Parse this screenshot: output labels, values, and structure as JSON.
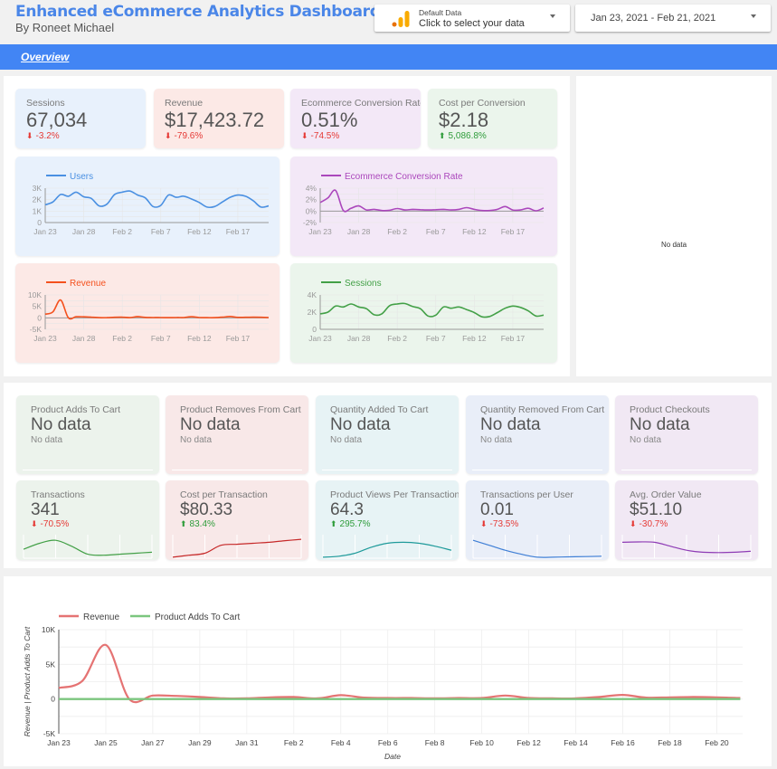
{
  "header": {
    "title": "Enhanced eCommerce Analytics  Dashboard",
    "subtitle": "By Roneet Michael",
    "data_source": {
      "label": "Default Data",
      "action": "Click to select your data",
      "icon": "google-analytics-icon"
    },
    "date_range": "Jan 23, 2021 - Feb 21, 2021"
  },
  "nav": {
    "tabs": [
      {
        "label": "Overview",
        "active": true
      }
    ]
  },
  "kpis_top": [
    {
      "label": "Sessions",
      "value": "67,034",
      "delta": "-3.2%",
      "trend": "down",
      "bg": "#e8f1fc"
    },
    {
      "label": "Revenue",
      "value": "$17,423.72",
      "delta": "-79.6%",
      "trend": "down",
      "bg": "#fce9e6"
    },
    {
      "label": "Ecommerce Conversion Rate",
      "value": "0.51%",
      "delta": "-74.5%",
      "trend": "down",
      "bg": "#f3e8f7"
    },
    {
      "label": "Cost per Conversion",
      "value": "$2.18",
      "delta": "5,086.8%",
      "trend": "up",
      "bg": "#ebf5ec"
    }
  ],
  "side_panel": {
    "message": "No data"
  },
  "kpis_nodata": [
    {
      "label": "Product Adds To Cart",
      "value": "No data",
      "sub": "No data",
      "bg": "#ecf3ec"
    },
    {
      "label": "Product Removes From Cart",
      "value": "No data",
      "sub": "No data",
      "bg": "#f8e8e8"
    },
    {
      "label": "Quantity Added To Cart",
      "value": "No data",
      "sub": "No data",
      "bg": "#e7f3f5"
    },
    {
      "label": "Quantity Removed From Cart",
      "value": "No data",
      "sub": "No data",
      "bg": "#e9eef8"
    },
    {
      "label": "Product Checkouts",
      "value": "No data",
      "sub": "No data",
      "bg": "#f1e8f4"
    }
  ],
  "kpis_spark": [
    {
      "label": "Transactions",
      "value": "341",
      "delta": "-70.5%",
      "trend": "down",
      "bg": "#ecf3ec",
      "color": "#43a047",
      "spark": [
        0.45,
        0.75,
        0.9,
        0.6,
        0.2,
        0.15,
        0.2,
        0.25,
        0.3
      ]
    },
    {
      "label": "Cost per Transaction",
      "value": "$80.33",
      "delta": "83.4%",
      "trend": "up",
      "bg": "#f8e8e8",
      "color": "#c62828",
      "spark": [
        0.05,
        0.15,
        0.25,
        0.65,
        0.7,
        0.75,
        0.8,
        0.88,
        0.95
      ]
    },
    {
      "label": "Product Views Per Transaction",
      "value": "64.3",
      "delta": "295.7%",
      "trend": "up",
      "bg": "#e7f3f5",
      "color": "#1e9a9a",
      "spark": [
        0.05,
        0.1,
        0.25,
        0.55,
        0.75,
        0.8,
        0.75,
        0.6,
        0.4
      ]
    },
    {
      "label": "Transactions per User",
      "value": "0.01",
      "delta": "-73.5%",
      "trend": "down",
      "bg": "#e9eef8",
      "color": "#3f7fd6",
      "spark": [
        0.9,
        0.65,
        0.4,
        0.2,
        0.05,
        0.05,
        0.07,
        0.08,
        0.1
      ]
    },
    {
      "label": "Avg. Order Value",
      "value": "$51.10",
      "delta": "-30.7%",
      "trend": "down",
      "bg": "#f1e8f4",
      "color": "#8e3bb5",
      "spark": [
        0.8,
        0.82,
        0.8,
        0.6,
        0.4,
        0.3,
        0.28,
        0.3,
        0.35
      ]
    }
  ],
  "chart_data": [
    {
      "type": "line",
      "title": "Users",
      "color": "#4a90e2",
      "bg": "#e8f1fc",
      "ylim": [
        0,
        3000
      ],
      "yticks": [
        "0",
        "1K",
        "2K",
        "3K"
      ],
      "ytick_values": [
        0,
        1000,
        2000,
        3000
      ],
      "xticks": [
        "Jan 23",
        "Jan 28",
        "Feb 2",
        "Feb 7",
        "Feb 12",
        "Feb 17"
      ],
      "values": [
        1550,
        1800,
        2450,
        2300,
        2650,
        2250,
        2100,
        1450,
        1600,
        2450,
        2650,
        2750,
        2400,
        2150,
        1400,
        1500,
        2400,
        2200,
        2300,
        2050,
        1750,
        1350,
        1400,
        1800,
        2200,
        2400,
        2300,
        1900,
        1350,
        1450
      ]
    },
    {
      "type": "line",
      "title": "Ecommerce Conversion Rate",
      "color": "#ab47bc",
      "bg": "#f3e8f7",
      "ylim": [
        -2,
        4
      ],
      "yticks": [
        "-2%",
        "0%",
        "2%",
        "4%"
      ],
      "ytick_values": [
        -2,
        0,
        2,
        4
      ],
      "xticks": [
        "Jan 23",
        "Jan 28",
        "Feb 2",
        "Feb 7",
        "Feb 12",
        "Feb 17"
      ],
      "values": [
        1.5,
        2.3,
        3.6,
        0.1,
        0.5,
        0.9,
        0.2,
        0.3,
        0.1,
        0.15,
        0.45,
        0.2,
        0.3,
        0.25,
        0.2,
        0.25,
        0.3,
        0.2,
        0.3,
        0.6,
        0.3,
        0.1,
        0.1,
        0.3,
        0.8,
        0.2,
        0.2,
        0.5,
        0.05,
        0.55
      ]
    },
    {
      "type": "line",
      "title": "Revenue",
      "color": "#f4511e",
      "bg": "#fce9e6",
      "ylim": [
        -5000,
        10000
      ],
      "yticks": [
        "-5K",
        "0",
        "5K",
        "10K"
      ],
      "ytick_values": [
        -5000,
        0,
        5000,
        10000
      ],
      "xticks": [
        "Jan 23",
        "Jan 28",
        "Feb 2",
        "Feb 7",
        "Feb 12",
        "Feb 17"
      ],
      "values": [
        1600,
        2600,
        7800,
        0,
        500,
        450,
        300,
        100,
        100,
        250,
        300,
        100,
        550,
        200,
        150,
        150,
        100,
        150,
        150,
        500,
        150,
        100,
        100,
        300,
        600,
        200,
        250,
        300,
        250,
        150
      ]
    },
    {
      "type": "line",
      "title": "Sessions",
      "color": "#43a047",
      "bg": "#ebf5ec",
      "ylim": [
        0,
        4000
      ],
      "yticks": [
        "0",
        "2K",
        "4K"
      ],
      "ytick_values": [
        0,
        2000,
        4000
      ],
      "xticks": [
        "Jan 23",
        "Jan 28",
        "Feb 2",
        "Feb 7",
        "Feb 12",
        "Feb 17"
      ],
      "values": [
        1800,
        2000,
        2700,
        2600,
        2950,
        2600,
        2400,
        1700,
        1800,
        2750,
        2950,
        3000,
        2650,
        2400,
        1550,
        1650,
        2600,
        2450,
        2600,
        2300,
        1950,
        1450,
        1500,
        1950,
        2450,
        2700,
        2550,
        2150,
        1550,
        1650
      ]
    },
    {
      "type": "line",
      "title": "",
      "xlabel": "Date",
      "ylabel": "Revenue | Product Adds To Cart",
      "ylim": [
        -5000,
        10000
      ],
      "yticks": [
        "-5K",
        "0",
        "5K",
        "10K"
      ],
      "ytick_values": [
        -5000,
        0,
        5000,
        10000
      ],
      "xticks": [
        "Jan 23",
        "Jan 25",
        "Jan 27",
        "Jan 29",
        "Jan 31",
        "Feb 2",
        "Feb 4",
        "Feb 6",
        "Feb 8",
        "Feb 10",
        "Feb 12",
        "Feb 14",
        "Feb 16",
        "Feb 18",
        "Feb 20"
      ],
      "legend": "top-left",
      "series": [
        {
          "name": "Revenue",
          "color": "#e57373",
          "values": [
            1600,
            2600,
            7800,
            0,
            500,
            450,
            300,
            100,
            100,
            250,
            300,
            100,
            550,
            200,
            150,
            150,
            100,
            150,
            150,
            500,
            150,
            100,
            100,
            300,
            600,
            200,
            250,
            300,
            250,
            150
          ]
        },
        {
          "name": "Product Adds To Cart",
          "color": "#7bc67e",
          "values": [
            0,
            0,
            0,
            0,
            0,
            0,
            0,
            0,
            0,
            0,
            0,
            0,
            0,
            0,
            0,
            0,
            0,
            0,
            0,
            0,
            0,
            0,
            0,
            0,
            0,
            0,
            0,
            0,
            0,
            0
          ]
        }
      ]
    }
  ]
}
